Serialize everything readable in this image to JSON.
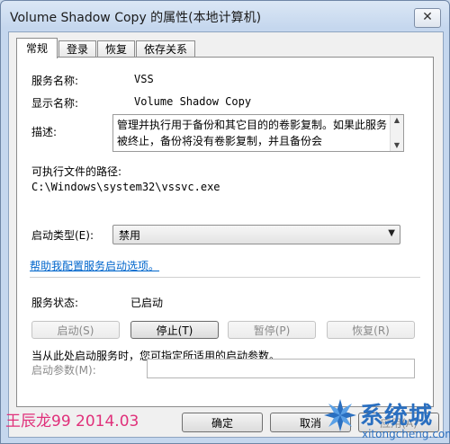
{
  "window": {
    "title": "Volume Shadow Copy 的属性(本地计算机)",
    "close_glyph": "✕"
  },
  "tabs": [
    {
      "label": "常规",
      "active": true
    },
    {
      "label": "登录",
      "active": false
    },
    {
      "label": "恢复",
      "active": false
    },
    {
      "label": "依存关系",
      "active": false
    }
  ],
  "general": {
    "service_name_label": "服务名称:",
    "service_name_value": "VSS",
    "display_name_label": "显示名称:",
    "display_name_value": "Volume Shadow Copy",
    "description_label": "描述:",
    "description_value": "管理并执行用于备份和其它目的的卷影复制。如果此服务被终止，备份将没有卷影复制，并且备份会",
    "exe_path_label": "可执行文件的路径:",
    "exe_path_value": "C:\\Windows\\system32\\vssvc.exe",
    "startup_type_label": "启动类型(E):",
    "startup_type_value": "禁用",
    "help_link": "帮助我配置服务启动选项。",
    "status_label": "服务状态:",
    "status_value": "已启动",
    "buttons": {
      "start": "启动(S)",
      "stop": "停止(T)",
      "pause": "暂停(P)",
      "resume": "恢复(R)"
    },
    "hint_text": "当从此处启动服务时，您可指定所适用的启动参数。",
    "start_params_label": "启动参数(M):",
    "start_params_value": ""
  },
  "footer": {
    "ok": "确定",
    "cancel": "取消",
    "apply": "应用(A)"
  },
  "watermarks": {
    "left": "王辰龙99 2014.03",
    "site_big": "系统城",
    "site_small": "xitongcheng.com"
  },
  "colors": {
    "link": "#0066cc",
    "watermark_pink": "#e0307a",
    "watermark_blue": "#2a6fc0"
  }
}
